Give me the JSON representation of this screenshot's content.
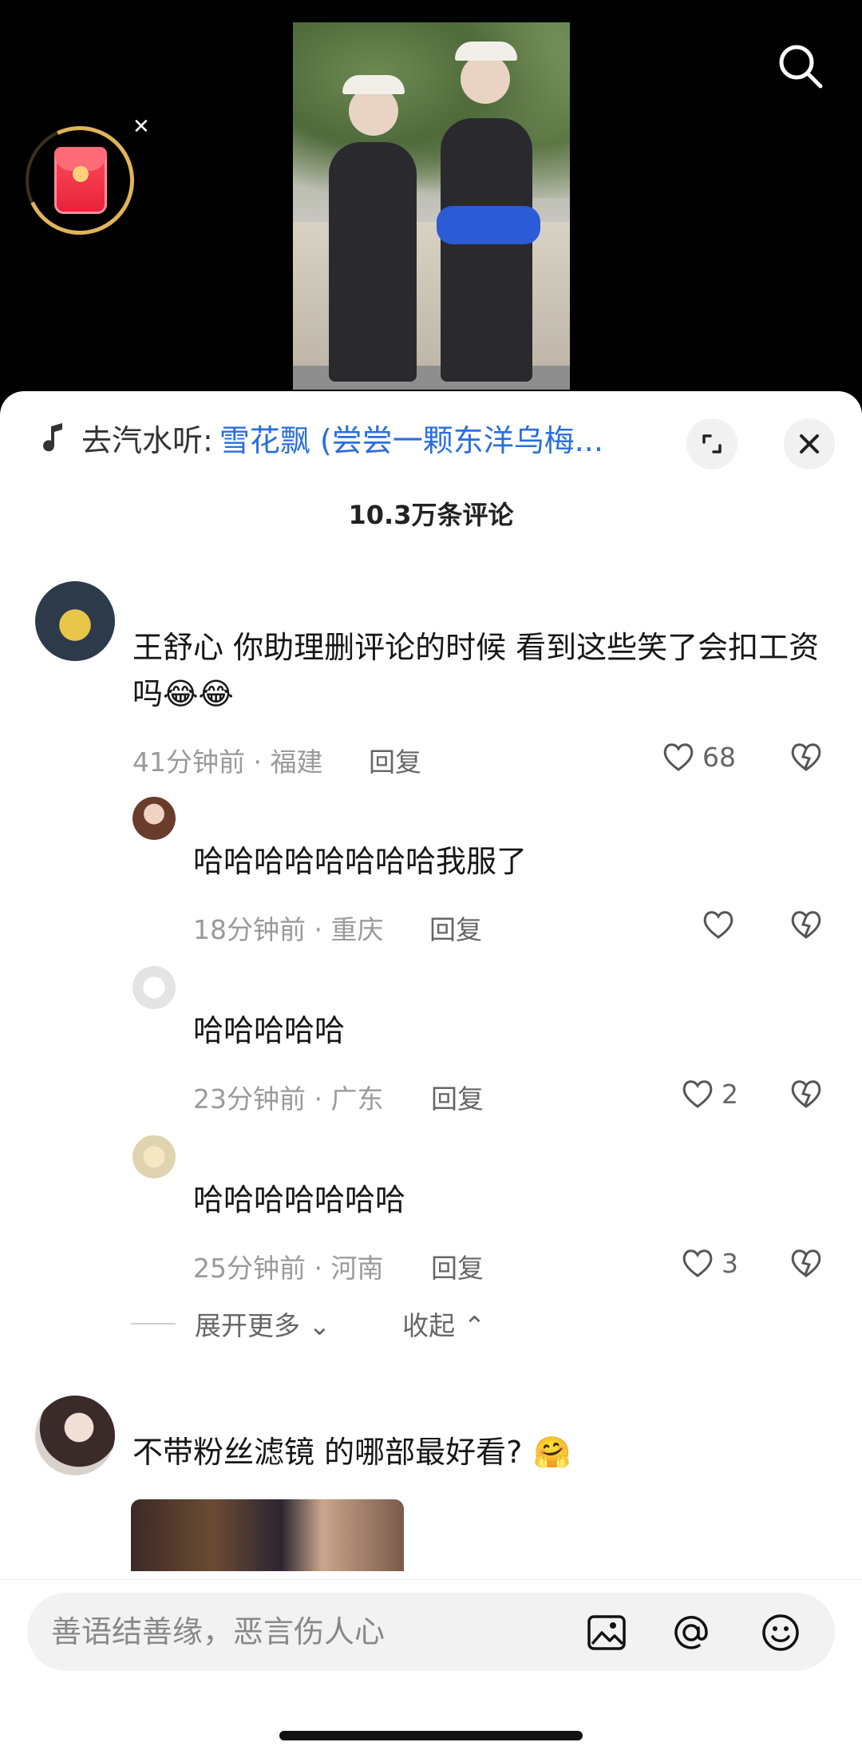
{
  "music": {
    "prefix": "去汽水听:",
    "song": "雪花飘 (尝尝一颗东洋乌梅..."
  },
  "comments_count": "10.3万条评论",
  "comments": [
    {
      "username": "",
      "text": "王舒心 你助理删评论的时候 看到这些笑了会扣工资吗",
      "emoji": "😂😂",
      "time": "41分钟前 · 福建",
      "reply_label": "回复",
      "likes": "68"
    },
    {
      "username": "",
      "text": "不带粉丝滤镜 的哪部最好看?",
      "emoji": "🤗",
      "time": "",
      "reply_label": "",
      "likes": ""
    }
  ],
  "replies": [
    {
      "username": "",
      "text": "哈哈哈哈哈哈哈哈我服了",
      "time": "18分钟前 · 重庆",
      "reply_label": "回复",
      "likes": ""
    },
    {
      "username": "",
      "text": "哈哈哈哈哈",
      "time": "23分钟前 · 广东",
      "reply_label": "回复",
      "likes": "2"
    },
    {
      "username": "",
      "text": "哈哈哈哈哈哈哈",
      "time": "25分钟前 · 河南",
      "reply_label": "回复",
      "likes": "3"
    }
  ],
  "more": {
    "expand": "展开更多",
    "collapse": "收起"
  },
  "input": {
    "placeholder": "善语结善缘，恶言伤人心"
  },
  "icons": {
    "search": "search-icon",
    "red_packet": "red-packet-icon",
    "music": "music-note-icon",
    "expand": "expand-icon",
    "close": "close-icon",
    "heart": "heart-icon",
    "broken_heart": "dislike-icon",
    "image": "image-icon",
    "mention": "at-icon",
    "emoji": "emoji-icon"
  },
  "colors": {
    "accent_link": "#2a6fdc",
    "red_packet": "#e6213a"
  }
}
